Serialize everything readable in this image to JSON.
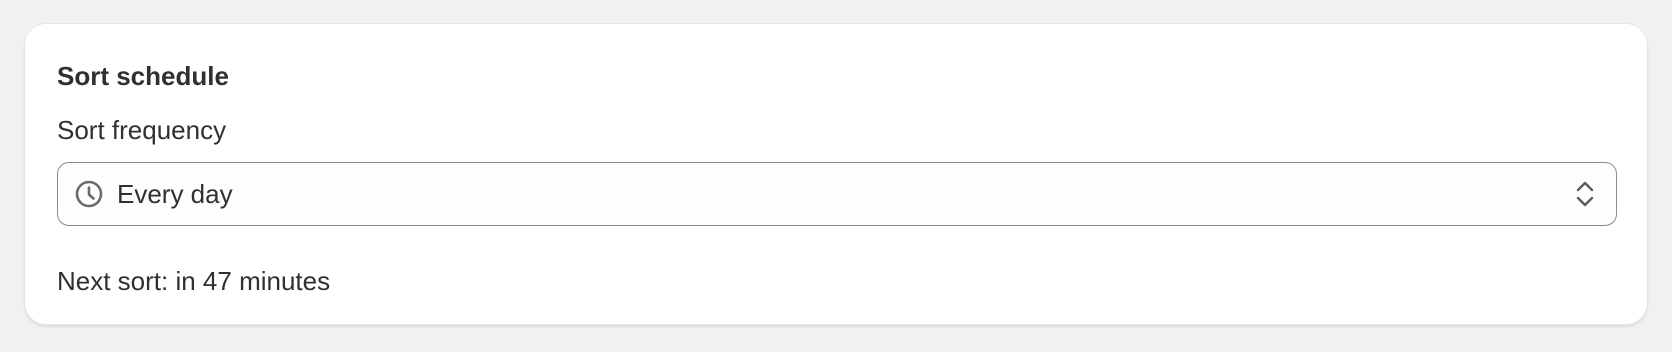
{
  "card": {
    "title": "Sort schedule",
    "frequency": {
      "label": "Sort frequency",
      "selected": "Every day",
      "icon": "clock-icon",
      "toggle_icon": "select-chevrons-icon"
    },
    "next_sort_text": "Next sort: in 47 minutes"
  }
}
